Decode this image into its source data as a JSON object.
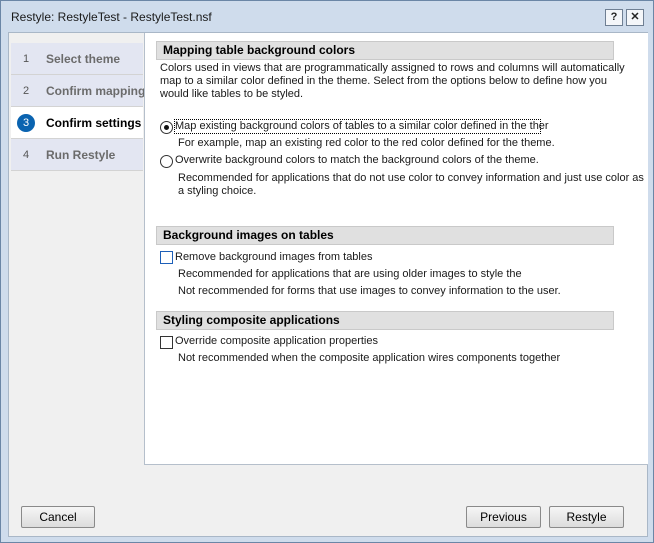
{
  "window": {
    "title": "Restyle: RestyleTest - RestyleTest.nsf",
    "help_label": "?",
    "close_label": "✕"
  },
  "steps": [
    {
      "num": "1",
      "label": "Select theme",
      "state": "done"
    },
    {
      "num": "2",
      "label": "Confirm mapping",
      "state": "done"
    },
    {
      "num": "3",
      "label": "Confirm settings",
      "state": "active"
    },
    {
      "num": "4",
      "label": "Run Restyle",
      "state": "todo"
    }
  ],
  "mapping": {
    "header": "Mapping table background colors",
    "description_lines": [
      "Colors used in views that are programmatically assigned to rows and columns will automatically",
      "map to a similar color defined in the theme. Select from the options below to define how you",
      "would like tables to be styled."
    ],
    "option1_label": "Map existing background colors of tables to a similar color defined in the ther",
    "option1_note": "For example, map an existing red color to the red color defined for the theme.",
    "option1_selected": true,
    "option2_label": "Overwrite background colors to match the background colors of the theme.",
    "option2_note_lines": [
      "Recommended for applications that do not use color to convey information and just use color as",
      "a styling choice."
    ],
    "option2_selected": false
  },
  "bg_images": {
    "header": "Background images on tables",
    "checkbox_label": "Remove background images from tables",
    "checked": false,
    "note_lines": [
      "Recommended for applications that are using older images to style the",
      "Not recommended for forms that use images to convey information to the user."
    ]
  },
  "composite": {
    "header": "Styling composite applications",
    "checkbox_label": "Override composite application properties",
    "checked": false,
    "note": "Not recommended when the composite application wires components together"
  },
  "buttons": {
    "cancel": "Cancel",
    "previous": "Previous",
    "restyle": "Restyle"
  }
}
